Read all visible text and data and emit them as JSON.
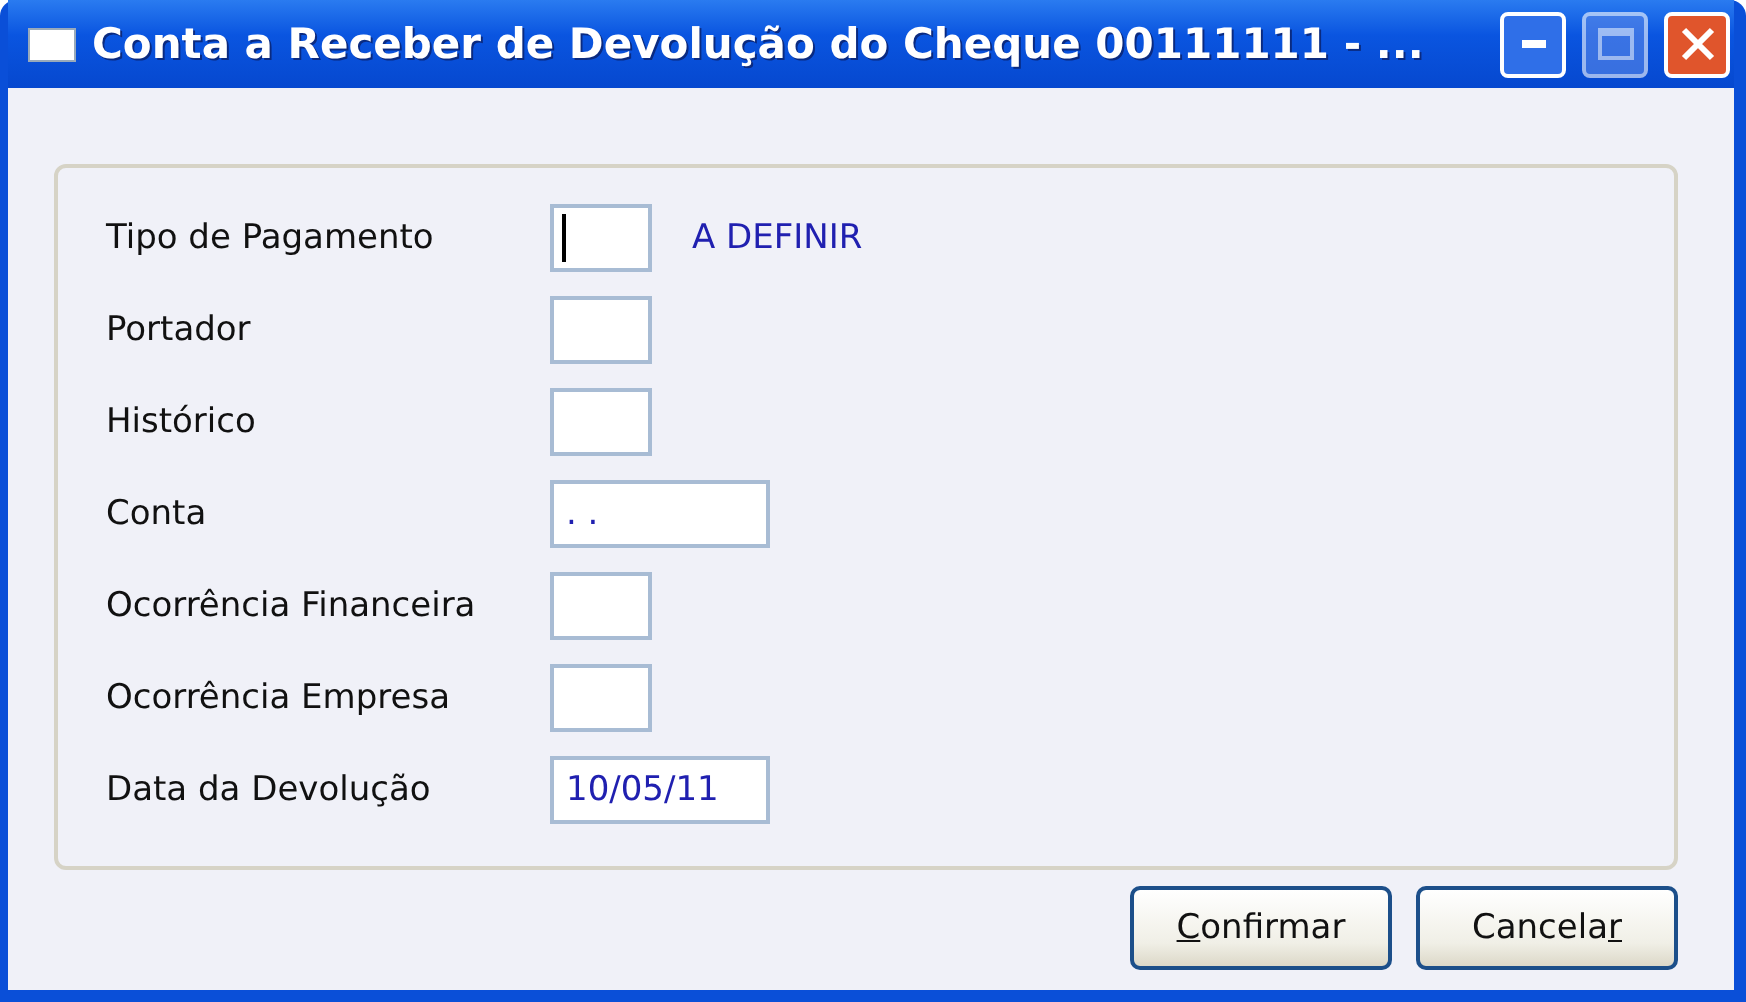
{
  "window": {
    "title": "Conta a Receber de Devolução do Cheque 00111111 - ..."
  },
  "fields": [
    {
      "label": "Tipo de Pagamento",
      "kind": "short",
      "focused": true,
      "note": "A DEFINIR"
    },
    {
      "label": "Portador",
      "kind": "short",
      "focused": false
    },
    {
      "label": "Histórico",
      "kind": "short",
      "focused": false
    },
    {
      "label": "Conta",
      "kind": "long",
      "focused": false,
      "value": ". ."
    },
    {
      "label": "Ocorrência Financeira",
      "kind": "short",
      "focused": false
    },
    {
      "label": "Ocorrência Empresa",
      "kind": "short",
      "focused": false
    },
    {
      "label": "Data da Devolução",
      "kind": "long",
      "focused": false,
      "value": "10/05/11"
    }
  ],
  "buttons": [
    {
      "key": "C",
      "post": "onfirmar"
    },
    {
      "pre": "Cancela",
      "key": "r"
    }
  ]
}
